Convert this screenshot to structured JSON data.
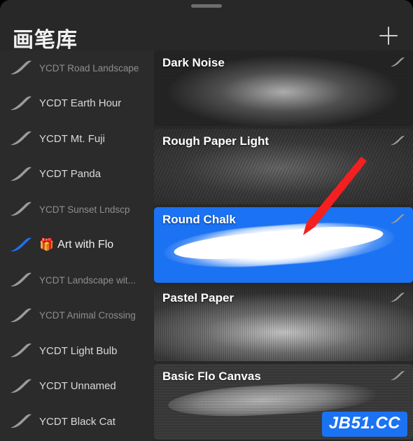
{
  "window": {
    "title": "画笔库",
    "add_icon": "plus-icon",
    "grabber": "drag-handle"
  },
  "sidebar": {
    "items": [
      {
        "label": "YCDT Road Landscape",
        "style": "dim",
        "icon": "brush-stroke-icon"
      },
      {
        "label": "YCDT Earth Hour",
        "style": "normal",
        "icon": "brush-stroke-icon"
      },
      {
        "label": "YCDT Mt. Fuji",
        "style": "normal",
        "icon": "brush-stroke-icon"
      },
      {
        "label": "YCDT Panda",
        "style": "normal",
        "icon": "brush-stroke-icon"
      },
      {
        "label": "YCDT Sunset Lndscp",
        "style": "dim",
        "icon": "brush-stroke-icon"
      },
      {
        "label": "Art with Flo",
        "style": "gift",
        "icon": "brush-stroke-icon-blue",
        "badge": "🎁"
      },
      {
        "label": "YCDT Landscape wit...",
        "style": "dim",
        "icon": "brush-stroke-icon"
      },
      {
        "label": "YCDT Animal Crossing",
        "style": "dim",
        "icon": "brush-stroke-icon"
      },
      {
        "label": "YCDT Light Bulb",
        "style": "normal",
        "icon": "brush-stroke-icon"
      },
      {
        "label": "YCDT Unnamed",
        "style": "normal",
        "icon": "brush-stroke-icon"
      },
      {
        "label": "YCDT Black Cat",
        "style": "normal",
        "icon": "brush-stroke-icon"
      }
    ]
  },
  "brushes": {
    "items": [
      {
        "name": "Dark Noise",
        "texture": "tex-darknoise",
        "selected": false,
        "icon": "brush-stroke-icon"
      },
      {
        "name": "Rough Paper Light",
        "texture": "tex-rough",
        "selected": false,
        "icon": "brush-stroke-icon"
      },
      {
        "name": "Round Chalk",
        "texture": "tex-chalk",
        "selected": true,
        "icon": "brush-stroke-icon"
      },
      {
        "name": "Pastel Paper",
        "texture": "tex-pastel",
        "selected": false,
        "icon": "brush-stroke-icon"
      },
      {
        "name": "Basic Flo Canvas",
        "texture": "tex-canvas",
        "selected": false,
        "icon": "brush-stroke-icon"
      }
    ]
  },
  "annotation": {
    "arrow": "red-arrow-pointer",
    "arrow_color": "#f41f1f",
    "target": "Round Chalk"
  },
  "watermark": {
    "text": "JB51.CC",
    "bg": "#1b72f2",
    "fg": "#ffffff"
  },
  "colors": {
    "accent": "#1b72f2",
    "panel_bg": "#282828",
    "sidebar_bg": "#2b2b2b",
    "card_bg": "#343434",
    "text_primary": "#f2f2f2",
    "text_dim": "#8e8e8e"
  }
}
